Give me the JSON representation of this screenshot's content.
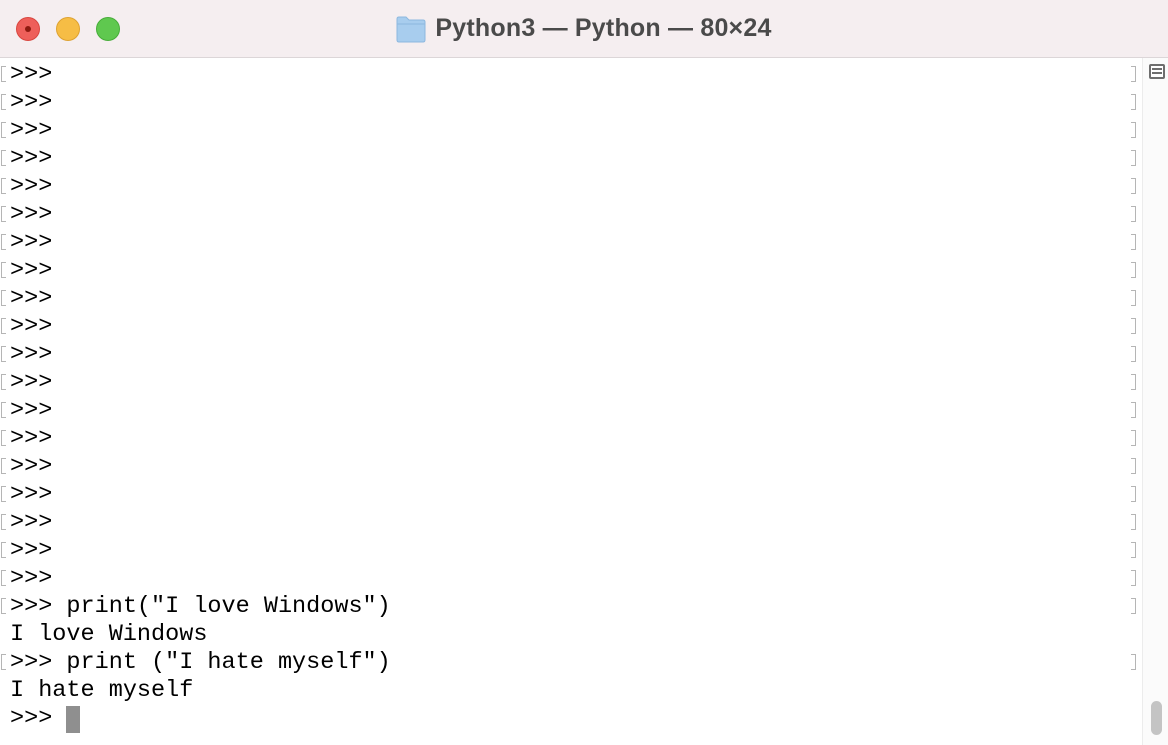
{
  "window": {
    "title": "Python3 — Python — 80×24"
  },
  "colors": {
    "titlebar_bg": "#f5eef0",
    "close": "#ee5f5a",
    "minimize": "#f6bd45",
    "maximize": "#5fc84f",
    "folder": "#a8cdee",
    "cursor": "#8f8f8f"
  },
  "icons": {
    "title": "folder-icon",
    "split": "split-pane-icon"
  },
  "terminal": {
    "lines": [
      {
        "text": ">>>",
        "marked": true
      },
      {
        "text": ">>>",
        "marked": true
      },
      {
        "text": ">>>",
        "marked": true
      },
      {
        "text": ">>>",
        "marked": true
      },
      {
        "text": ">>>",
        "marked": true
      },
      {
        "text": ">>>",
        "marked": true
      },
      {
        "text": ">>>",
        "marked": true
      },
      {
        "text": ">>>",
        "marked": true
      },
      {
        "text": ">>>",
        "marked": true
      },
      {
        "text": ">>>",
        "marked": true
      },
      {
        "text": ">>>",
        "marked": true
      },
      {
        "text": ">>>",
        "marked": true
      },
      {
        "text": ">>>",
        "marked": true
      },
      {
        "text": ">>>",
        "marked": true
      },
      {
        "text": ">>>",
        "marked": true
      },
      {
        "text": ">>>",
        "marked": true
      },
      {
        "text": ">>>",
        "marked": true
      },
      {
        "text": ">>>",
        "marked": true
      },
      {
        "text": ">>>",
        "marked": true
      },
      {
        "text": ">>> print(\"I love Windows\")",
        "marked": true
      },
      {
        "text": "I love Windows",
        "marked": false
      },
      {
        "text": ">>> print (\"I hate myself\")",
        "marked": true
      },
      {
        "text": "I hate myself",
        "marked": false
      },
      {
        "text": ">>> ",
        "marked": false,
        "cursor": true
      }
    ]
  }
}
